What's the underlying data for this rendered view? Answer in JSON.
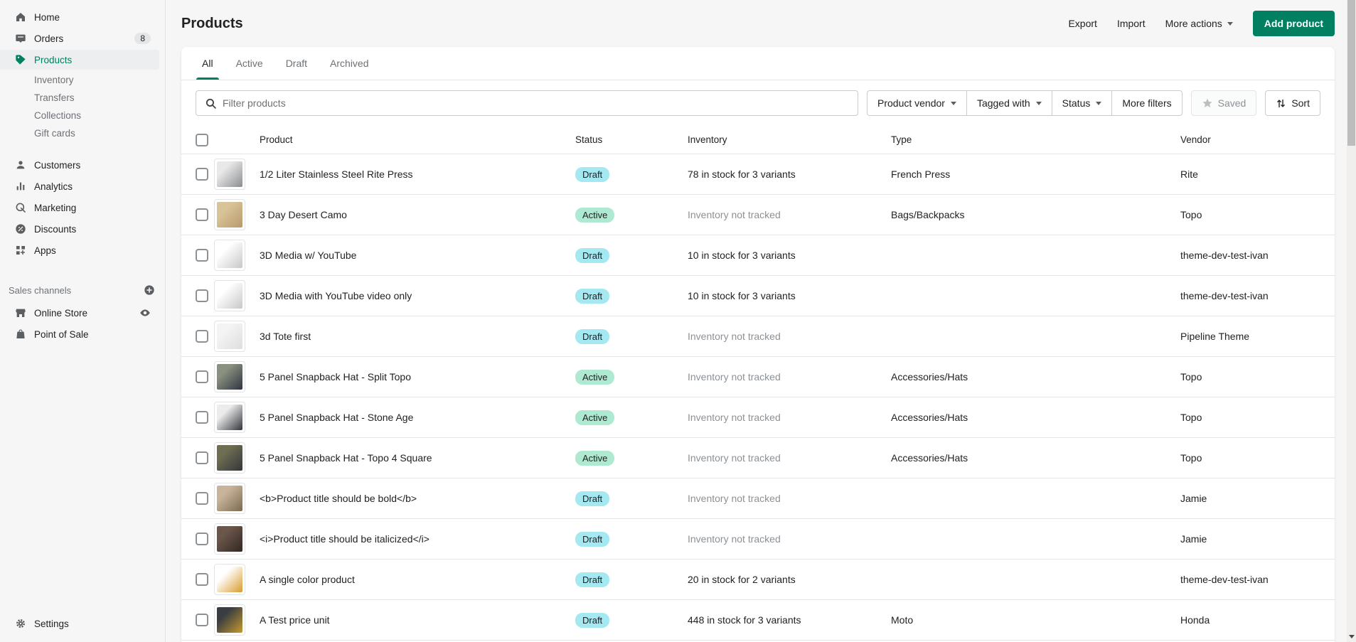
{
  "colors": {
    "accent": "#008060",
    "badge_draft": "#a4e8f2",
    "badge_active": "#aee9d1",
    "background": "#f6f6f7",
    "muted_text": "#8c9196"
  },
  "sidebar": {
    "items": [
      {
        "label": "Home"
      },
      {
        "label": "Orders",
        "badge": "8"
      },
      {
        "label": "Products",
        "selected": true
      },
      {
        "label": "Inventory"
      },
      {
        "label": "Transfers"
      },
      {
        "label": "Collections"
      },
      {
        "label": "Gift cards"
      },
      {
        "label": "Customers"
      },
      {
        "label": "Analytics"
      },
      {
        "label": "Marketing"
      },
      {
        "label": "Discounts"
      },
      {
        "label": "Apps"
      }
    ],
    "sales_channels": {
      "heading": "Sales channels",
      "items": [
        {
          "label": "Online Store"
        },
        {
          "label": "Point of Sale"
        }
      ]
    },
    "settings_label": "Settings"
  },
  "header": {
    "title": "Products",
    "export_label": "Export",
    "import_label": "Import",
    "more_actions_label": "More actions",
    "add_product_label": "Add product"
  },
  "tabs": [
    {
      "label": "All",
      "active": true
    },
    {
      "label": "Active"
    },
    {
      "label": "Draft"
    },
    {
      "label": "Archived"
    }
  ],
  "filters": {
    "search_placeholder": "Filter products",
    "product_vendor_label": "Product vendor",
    "tagged_with_label": "Tagged with",
    "status_label": "Status",
    "more_filters_label": "More filters",
    "saved_label": "Saved",
    "sort_label": "Sort"
  },
  "table": {
    "columns": [
      "Product",
      "Status",
      "Inventory",
      "Type",
      "Vendor"
    ],
    "rows": [
      {
        "title": "1/2 Liter Stainless Steel Rite Press",
        "status": "Draft",
        "inventory": "78 in stock for 3 variants",
        "type": "French Press",
        "vendor": "Rite",
        "thumb": [
          "#e8e8e8",
          "#8a8d90"
        ]
      },
      {
        "title": "3 Day Desert Camo",
        "status": "Active",
        "inventory": "Inventory not tracked",
        "type": "Bags/Backpacks",
        "vendor": "Topo",
        "thumb": [
          "#d9c49a",
          "#b89a6a"
        ]
      },
      {
        "title": "3D Media w/ YouTube",
        "status": "Draft",
        "inventory": "10 in stock for 3 variants",
        "type": "",
        "vendor": "theme-dev-test-ivan",
        "thumb": [
          "#ffffff",
          "#c7c7c7"
        ]
      },
      {
        "title": "3D Media with YouTube video only",
        "status": "Draft",
        "inventory": "10 in stock for 3 variants",
        "type": "",
        "vendor": "theme-dev-test-ivan",
        "thumb": [
          "#ffffff",
          "#c7c7c7"
        ]
      },
      {
        "title": "3d Tote first",
        "status": "Draft",
        "inventory": "Inventory not tracked",
        "type": "",
        "vendor": "Pipeline Theme",
        "thumb": [
          "#f4f4f4",
          "#dedede"
        ]
      },
      {
        "title": "5 Panel Snapback Hat - Split Topo",
        "status": "Active",
        "inventory": "Inventory not tracked",
        "type": "Accessories/Hats",
        "vendor": "Topo",
        "thumb": [
          "#8a9180",
          "#2e3440"
        ]
      },
      {
        "title": "5 Panel Snapback Hat - Stone Age",
        "status": "Active",
        "inventory": "Inventory not tracked",
        "type": "Accessories/Hats",
        "vendor": "Topo",
        "thumb": [
          "#ececec",
          "#31343a"
        ]
      },
      {
        "title": "5 Panel Snapback Hat - Topo 4 Square",
        "status": "Active",
        "inventory": "Inventory not tracked",
        "type": "Accessories/Hats",
        "vendor": "Topo",
        "thumb": [
          "#6f6d52",
          "#33363c"
        ]
      },
      {
        "title": "<b>Product title should be bold</b>",
        "status": "Draft",
        "inventory": "Inventory not tracked",
        "type": "",
        "vendor": "Jamie",
        "thumb": [
          "#c8b49a",
          "#7a6a52"
        ]
      },
      {
        "title": "<i>Product title should be italicized</i>",
        "status": "Draft",
        "inventory": "Inventory not tracked",
        "type": "",
        "vendor": "Jamie",
        "thumb": [
          "#6b564a",
          "#2f2721"
        ]
      },
      {
        "title": "A single color product",
        "status": "Draft",
        "inventory": "20 in stock for 2 variants",
        "type": "",
        "vendor": "theme-dev-test-ivan",
        "thumb": [
          "#ffffff",
          "#d99a2b"
        ]
      },
      {
        "title": "A Test price unit",
        "status": "Draft",
        "inventory": "448 in stock for 3 variants",
        "type": "Moto",
        "vendor": "Honda",
        "thumb": [
          "#3a3d42",
          "#c79a2e"
        ]
      }
    ]
  }
}
